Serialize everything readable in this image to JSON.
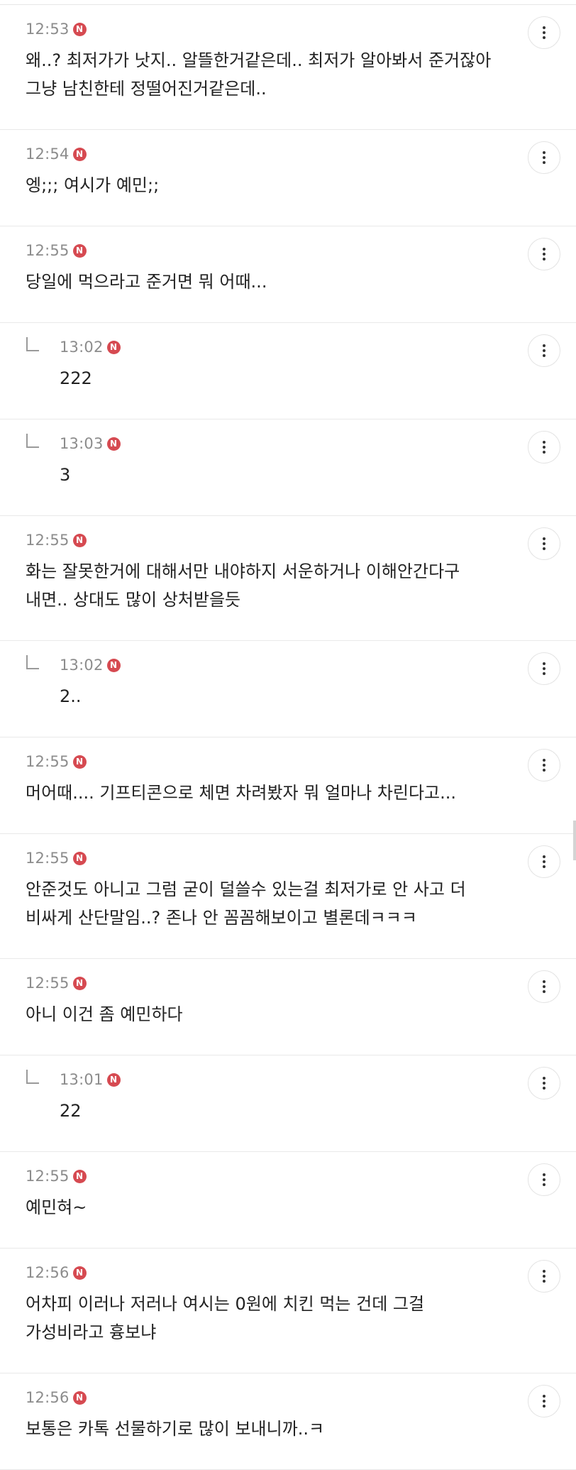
{
  "comments": [
    {
      "time": "12:53",
      "badge": "N",
      "reply": false,
      "text": "왜..? 최저가가 낫지.. 알뜰한거같은데.. 최저가 알아봐서 준거잖아\n그냥 남친한테 정떨어진거같은데..",
      "lines": 2
    },
    {
      "time": "12:54",
      "badge": "N",
      "reply": false,
      "text": "엥;;; 여시가 예민;;",
      "lines": 1
    },
    {
      "time": "12:55",
      "badge": "N",
      "reply": false,
      "text": "당일에 먹으라고 준거면 뭐 어때...",
      "lines": 1
    },
    {
      "time": "13:02",
      "badge": "N",
      "reply": true,
      "text": "222",
      "lines": 1
    },
    {
      "time": "13:03",
      "badge": "N",
      "reply": true,
      "text": "3",
      "lines": 1
    },
    {
      "time": "12:55",
      "badge": "N",
      "reply": false,
      "text": "화는 잘못한거에 대해서만 내야하지 서운하거나 이해안간다구\n내면.. 상대도 많이 상처받을듯",
      "lines": 2
    },
    {
      "time": "13:02",
      "badge": "N",
      "reply": true,
      "text": "2..",
      "lines": 1
    },
    {
      "time": "12:55",
      "badge": "N",
      "reply": false,
      "text": "머어때.... 기프티콘으로 체면 차려봤자 뭐 얼마나 차린다고...",
      "lines": 1
    },
    {
      "time": "12:55",
      "badge": "N",
      "reply": false,
      "text": "안준것도 아니고 그럼 굳이 덜쓸수 있는걸 최저가로 안 사고 더\n비싸게 산단말임..? 존나 안 꼼꼼해보이고 별론데ㅋㅋㅋ",
      "lines": 2
    },
    {
      "time": "12:55",
      "badge": "N",
      "reply": false,
      "text": "아니 이건 좀 예민하다",
      "lines": 1
    },
    {
      "time": "13:01",
      "badge": "N",
      "reply": true,
      "text": "22",
      "lines": 1
    },
    {
      "time": "12:55",
      "badge": "N",
      "reply": false,
      "text": "예민혀~",
      "lines": 1
    },
    {
      "time": "12:56",
      "badge": "N",
      "reply": false,
      "text": "어차피 이러나 저러나 여시는 0원에 치킨 먹는 건데 그걸\n가성비라고 흉보냐",
      "lines": 2
    },
    {
      "time": "12:56",
      "badge": "N",
      "reply": false,
      "text": "보통은 카톡 선물하기로 많이 보내니까..ㅋ",
      "lines": 1
    }
  ]
}
